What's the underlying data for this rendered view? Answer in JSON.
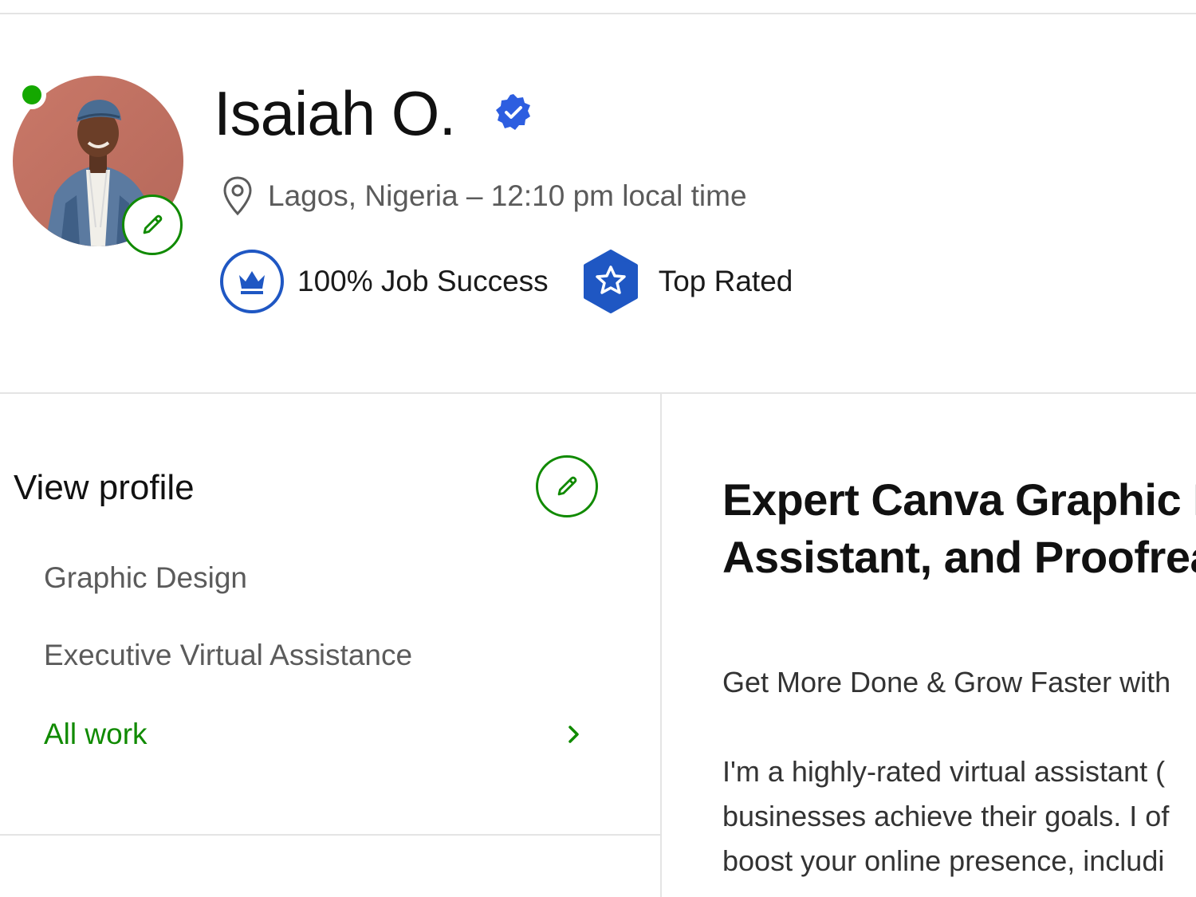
{
  "profile": {
    "name": "Isaiah O.",
    "location": "Lagos, Nigeria – 12:10 pm local time",
    "job_success": "100% Job Success",
    "top_rated": "Top Rated"
  },
  "sidebar": {
    "heading": "View profile",
    "specialties": [
      "Graphic Design",
      "Executive Virtual Assistance"
    ],
    "all_work": "All work"
  },
  "main": {
    "title_lines": [
      "Expert Canva Graphic I",
      "Assistant, and Proofrea"
    ],
    "intro": "Get More Done & Grow Faster with",
    "bio_lines": [
      "I'm a highly-rated virtual assistant (",
      "businesses achieve their goals. I of",
      "boost your online presence, includi"
    ]
  },
  "colors": {
    "brand_green": "#108a00",
    "online_green": "#14a800",
    "badge_blue": "#1f57c3",
    "verified_blue": "#2d5ee0"
  },
  "icons": [
    "online-status-dot",
    "pencil-icon",
    "verified-badge-icon",
    "location-pin-icon",
    "crown-icon",
    "star-badge-icon",
    "chevron-right-icon"
  ]
}
